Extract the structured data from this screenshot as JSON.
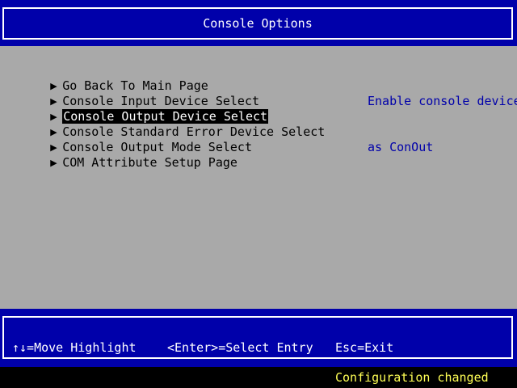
{
  "header": {
    "title": "Console Options"
  },
  "menu": {
    "items": [
      {
        "label": "Go Back To Main Page",
        "icon": "right-triangle-icon"
      },
      {
        "label": "Console Input Device Select",
        "icon": "right-triangle-icon"
      },
      {
        "label": "Console Output Device Select",
        "icon": "right-triangle-icon"
      },
      {
        "label": "Console Standard Error Device Select",
        "icon": "right-triangle-icon"
      },
      {
        "label": "Console Output Mode Select",
        "icon": "right-triangle-icon"
      },
      {
        "label": "COM Attribute Setup Page",
        "icon": "right-triangle-icon"
      }
    ],
    "selected_label": "Console Output Device Select"
  },
  "help": {
    "line1": "Enable console device",
    "line2": "as ConOut"
  },
  "footer": {
    "move_hint": "↑↓=Move Highlight",
    "enter_hint": "<Enter>=Select Entry",
    "esc_hint": "Esc=Exit"
  },
  "status": {
    "message": "Configuration changed"
  },
  "colors": {
    "band_blue": "#0000aa",
    "panel_gray": "#a9a9a9",
    "help_blue": "#0000aa",
    "status_yellow": "#ffff55"
  }
}
